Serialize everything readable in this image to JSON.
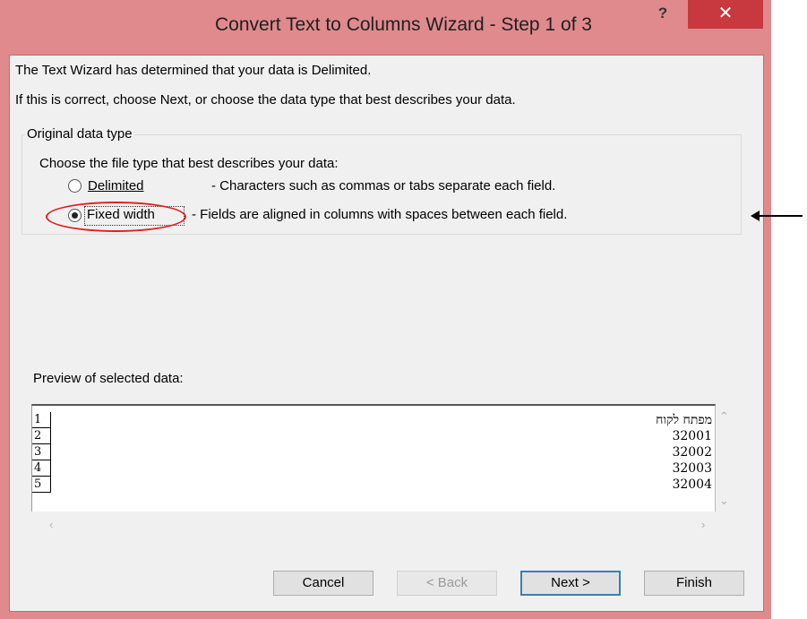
{
  "window": {
    "title": "Convert Text to Columns Wizard - Step 1 of 3",
    "help_label": "?",
    "close_label": "✕"
  },
  "intro": {
    "line1": "The Text Wizard has determined that your data is Delimited.",
    "line2": "If this is correct, choose Next, or choose the data type that best describes your data."
  },
  "original_data_type": {
    "legend": "Original data type",
    "prompt": "Choose the file type that best describes your data:",
    "options": [
      {
        "label": "Delimited",
        "description": "- Characters such as commas or tabs separate each field.",
        "selected": false
      },
      {
        "label": "Fixed width",
        "description": "- Fields are aligned in columns with spaces between each field.",
        "selected": true
      }
    ]
  },
  "preview": {
    "label": "Preview of selected data:",
    "rows": [
      {
        "num": "1",
        "text": "מפתח לקוח"
      },
      {
        "num": "2",
        "text": "32001"
      },
      {
        "num": "3",
        "text": "32002"
      },
      {
        "num": "4",
        "text": "32003"
      },
      {
        "num": "5",
        "text": "32004"
      }
    ]
  },
  "buttons": {
    "cancel": "Cancel",
    "back": "< Back",
    "next": "Next >",
    "finish": "Finish"
  },
  "colors": {
    "window_frame": "#e08a8e",
    "close_button": "#c7383f",
    "annotation_red": "#e02020"
  }
}
